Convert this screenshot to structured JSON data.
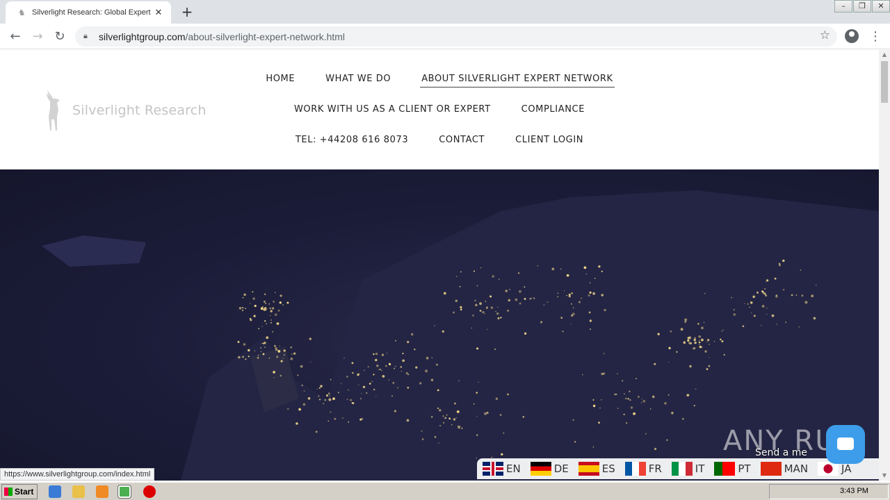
{
  "browser": {
    "tab_title": "Silverlight Research: Global Expert N",
    "url_host": "silverlightgroup.com",
    "url_path": "/about-silverlight-expert-network.html",
    "status_url": "https://www.silverlightgroup.com/index.html"
  },
  "site": {
    "brand": "Silverlight Research",
    "menu_row1": [
      "HOME",
      "WHAT WE DO",
      "ABOUT SILVERLIGHT EXPERT NETWORK"
    ],
    "menu_row2": [
      "WORK WITH US AS A CLIENT OR EXPERT",
      "COMPLIANCE"
    ],
    "menu_row3": [
      "TEL: +44208 616 8073",
      "CONTACT",
      "CLIENT LOGIN"
    ],
    "active_item": "ABOUT SILVERLIGHT EXPERT NETWORK"
  },
  "languages": [
    {
      "code": "EN",
      "flag": "uk-flag-icon"
    },
    {
      "code": "DE",
      "flag": "germany-flag-icon"
    },
    {
      "code": "ES",
      "flag": "spain-flag-icon"
    },
    {
      "code": "FR",
      "flag": "france-flag-icon"
    },
    {
      "code": "IT",
      "flag": "italy-flag-icon"
    },
    {
      "code": "PT",
      "flag": "portugal-flag-icon"
    },
    {
      "code": "MAN",
      "flag": "china-flag-icon"
    },
    {
      "code": "JA",
      "flag": "japan-flag-icon"
    }
  ],
  "chat": {
    "label": "Send a me"
  },
  "watermark": "ANY RUN",
  "taskbar": {
    "start_label": "Start",
    "clock": "3:43 PM"
  }
}
